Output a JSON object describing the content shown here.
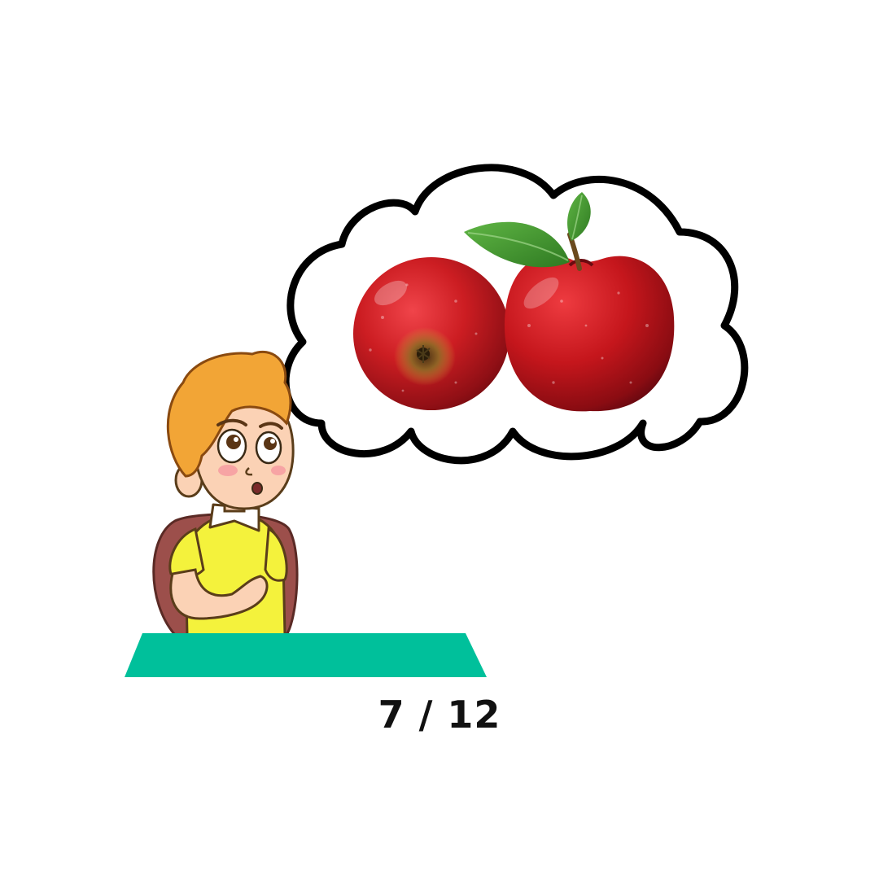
{
  "counter": {
    "current": "7",
    "separator": " / ",
    "total": "12",
    "display": "7 / 12"
  },
  "scene": {
    "character": "boy-thinking",
    "thought_object": "two-red-apples",
    "apple_count": 2
  },
  "colors": {
    "background": "#ffffff",
    "desk": "#00c09b",
    "shirt": "#f4f23c",
    "hair": "#f2a536",
    "chair": "#9c4f4b",
    "apple": "#c0171e",
    "leaf": "#4a9c34",
    "bubble_outline": "#000000",
    "counter_text": "#111111"
  }
}
